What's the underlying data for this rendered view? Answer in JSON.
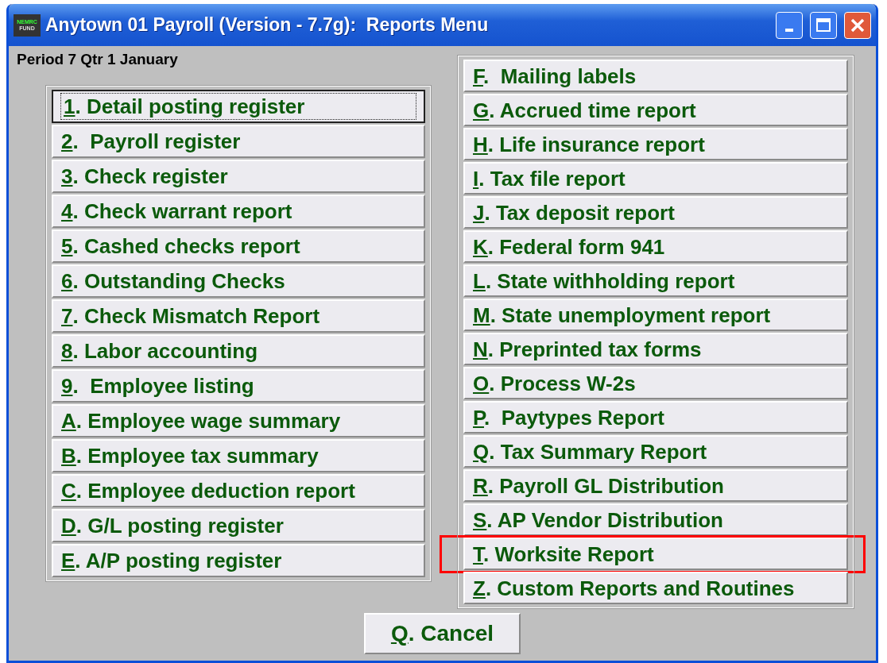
{
  "window": {
    "title": "Anytown 01 Payroll (Version - 7.7g):  Reports Menu",
    "logo": [
      "NEMRC",
      "FUND"
    ]
  },
  "period": "Period 7 Qtr 1 January",
  "left_menu": [
    {
      "mnemonic": "1",
      "text": ". Detail posting register",
      "focused": true,
      "highlighted": false
    },
    {
      "mnemonic": "2",
      "text": ".  Payroll register",
      "focused": false,
      "highlighted": false
    },
    {
      "mnemonic": "3",
      "text": ". Check register",
      "focused": false,
      "highlighted": false
    },
    {
      "mnemonic": "4",
      "text": ". Check warrant report",
      "focused": false,
      "highlighted": false
    },
    {
      "mnemonic": "5",
      "text": ". Cashed checks report",
      "focused": false,
      "highlighted": false
    },
    {
      "mnemonic": "6",
      "text": ". Outstanding Checks",
      "focused": false,
      "highlighted": false
    },
    {
      "mnemonic": "7",
      "text": ". Check Mismatch Report",
      "focused": false,
      "highlighted": false
    },
    {
      "mnemonic": "8",
      "text": ". Labor accounting",
      "focused": false,
      "highlighted": false
    },
    {
      "mnemonic": "9",
      "text": ".  Employee listing",
      "focused": false,
      "highlighted": false
    },
    {
      "mnemonic": "A",
      "text": ". Employee wage summary",
      "focused": false,
      "highlighted": false
    },
    {
      "mnemonic": "B",
      "text": ". Employee tax summary",
      "focused": false,
      "highlighted": false
    },
    {
      "mnemonic": "C",
      "text": ". Employee deduction report",
      "focused": false,
      "highlighted": false
    },
    {
      "mnemonic": "D",
      "text": ". G/L posting register",
      "focused": false,
      "highlighted": false
    },
    {
      "mnemonic": "E",
      "text": ". A/P posting register",
      "focused": false,
      "highlighted": false
    }
  ],
  "right_menu": [
    {
      "mnemonic": "F",
      "text": ".  Mailing labels",
      "focused": false,
      "highlighted": false
    },
    {
      "mnemonic": "G",
      "text": ". Accrued time report",
      "focused": false,
      "highlighted": false
    },
    {
      "mnemonic": "H",
      "text": ". Life insurance report",
      "focused": false,
      "highlighted": false
    },
    {
      "mnemonic": "I",
      "text": ". Tax file report",
      "focused": false,
      "highlighted": false
    },
    {
      "mnemonic": "J",
      "text": ". Tax deposit report",
      "focused": false,
      "highlighted": false
    },
    {
      "mnemonic": "K",
      "text": ". Federal form 941",
      "focused": false,
      "highlighted": false
    },
    {
      "mnemonic": "L",
      "text": ". State withholding report",
      "focused": false,
      "highlighted": false
    },
    {
      "mnemonic": "M",
      "text": ". State unemployment report",
      "focused": false,
      "highlighted": false
    },
    {
      "mnemonic": "N",
      "text": ". Preprinted tax forms",
      "focused": false,
      "highlighted": false
    },
    {
      "mnemonic": "O",
      "text": ". Process W-2s",
      "focused": false,
      "highlighted": false
    },
    {
      "mnemonic": "P",
      "text": ".  Paytypes Report",
      "focused": false,
      "highlighted": false
    },
    {
      "mnemonic": "Q",
      "text": ". Tax Summary Report",
      "focused": false,
      "highlighted": false
    },
    {
      "mnemonic": "R",
      "text": ". Payroll GL Distribution",
      "focused": false,
      "highlighted": false
    },
    {
      "mnemonic": "S",
      "text": ". AP Vendor Distribution",
      "focused": false,
      "highlighted": false
    },
    {
      "mnemonic": "T",
      "text": ". Worksite Report",
      "focused": false,
      "highlighted": true
    },
    {
      "mnemonic": "Z",
      "text": ". Custom Reports and Routines",
      "focused": false,
      "highlighted": false
    }
  ],
  "cancel": {
    "mnemonic": "Q",
    "text": ". Cancel"
  }
}
